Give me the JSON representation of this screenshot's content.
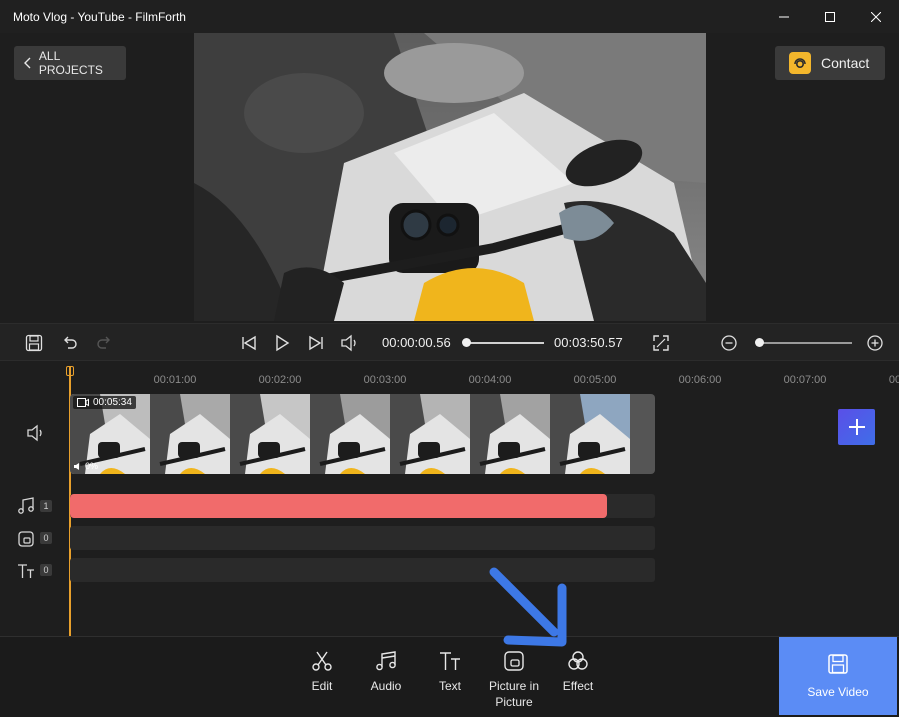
{
  "window": {
    "title": "Moto Vlog - YouTube - FilmForth",
    "controls": [
      "minimize",
      "maximize",
      "close"
    ]
  },
  "header": {
    "back_label": "ALL PROJECTS",
    "contact_label": "Contact"
  },
  "playback": {
    "current_time": "00:00:00.56",
    "total_time": "00:03:50.57",
    "progress": 0.0024
  },
  "timeline": {
    "ruler_labels": [
      "00:01:00",
      "00:02:00",
      "00:03:00",
      "00:04:00",
      "00:05:00",
      "00:06:00",
      "00:07:00",
      "00"
    ],
    "clip": {
      "duration": "00:05:34",
      "volume": "0%",
      "frame_count": 7
    },
    "tracks": [
      {
        "type": "audio",
        "count": "1"
      },
      {
        "type": "picture-in-picture",
        "count": "0"
      },
      {
        "type": "text",
        "count": "0"
      }
    ]
  },
  "toolbar": {
    "edit_label": "Edit",
    "audio_label": "Audio",
    "text_label": "Text",
    "pip_label": "Picture in Picture",
    "effect_label": "Effect",
    "save_label": "Save Video"
  },
  "colors": {
    "accent": "#5b8cf5",
    "audio_track": "#f16b6b",
    "playhead": "#e8a02c",
    "contact_icon": "#f3b62c",
    "arrow": "#3d78e6"
  },
  "icons": [
    "chevron-left-icon",
    "support-agent-icon",
    "save-icon",
    "undo-icon",
    "redo-icon",
    "skip-back-icon",
    "play-icon",
    "skip-forward-icon",
    "volume-icon",
    "fullscreen-icon",
    "zoom-out-icon",
    "zoom-in-icon",
    "plus-icon",
    "music-note-icon",
    "pip-icon",
    "text-icon",
    "scissors-icon",
    "effect-icon"
  ]
}
